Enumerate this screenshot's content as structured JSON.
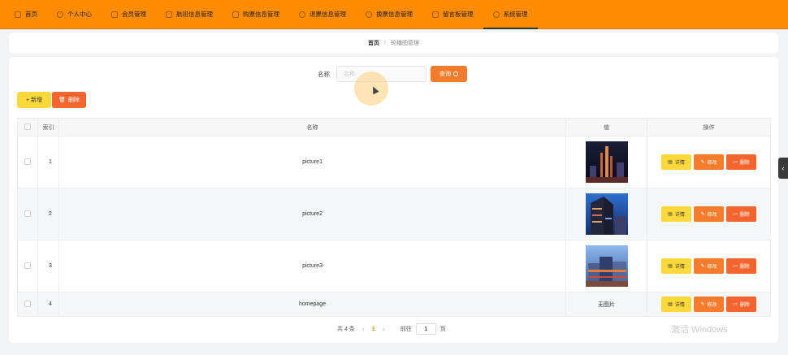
{
  "nav": {
    "items": [
      {
        "label": "首页",
        "icon": "home-icon"
      },
      {
        "label": "个人中心",
        "icon": "user-icon"
      },
      {
        "label": "会员管理",
        "icon": "chart-icon"
      },
      {
        "label": "航班信息管理",
        "icon": "menu-icon"
      },
      {
        "label": "购票信息管理",
        "icon": "menu-icon"
      },
      {
        "label": "退票信息管理",
        "icon": "refresh-icon"
      },
      {
        "label": "换票信息管理",
        "icon": "location-icon"
      },
      {
        "label": "留言板管理",
        "icon": "menu-icon"
      },
      {
        "label": "系统管理",
        "icon": "gear-icon"
      }
    ],
    "active_index": 8,
    "bg_color": "#ff8c00"
  },
  "breadcrumb": {
    "home": "首页",
    "separator": "/",
    "current": "轮播图管理"
  },
  "search": {
    "label": "名称",
    "placeholder": "名称",
    "query_button": "查询"
  },
  "actions": {
    "add_button": "+ 新增",
    "delete_button": "删除"
  },
  "table": {
    "headers": {
      "index": "索引",
      "name": "名称",
      "value": "值",
      "ops": "操作"
    },
    "rows": [
      {
        "index": "1",
        "name": "picture1",
        "value": "",
        "thumb": "city-night-1"
      },
      {
        "index": "2",
        "name": "picture2",
        "value": "",
        "thumb": "city-night-2"
      },
      {
        "index": "3",
        "name": "picture3",
        "value": "",
        "thumb": "city-night-3"
      },
      {
        "index": "4",
        "name": "homepage",
        "value": "无图片",
        "thumb": ""
      }
    ],
    "row_ops": {
      "detail": "详情",
      "edit": "修改",
      "delete": "删除"
    }
  },
  "pagination": {
    "total": "共 4 条",
    "current_page": "1",
    "goto_label": "前往",
    "goto_value": "1",
    "page_suffix": "页"
  },
  "watermark": "激活 Windows"
}
